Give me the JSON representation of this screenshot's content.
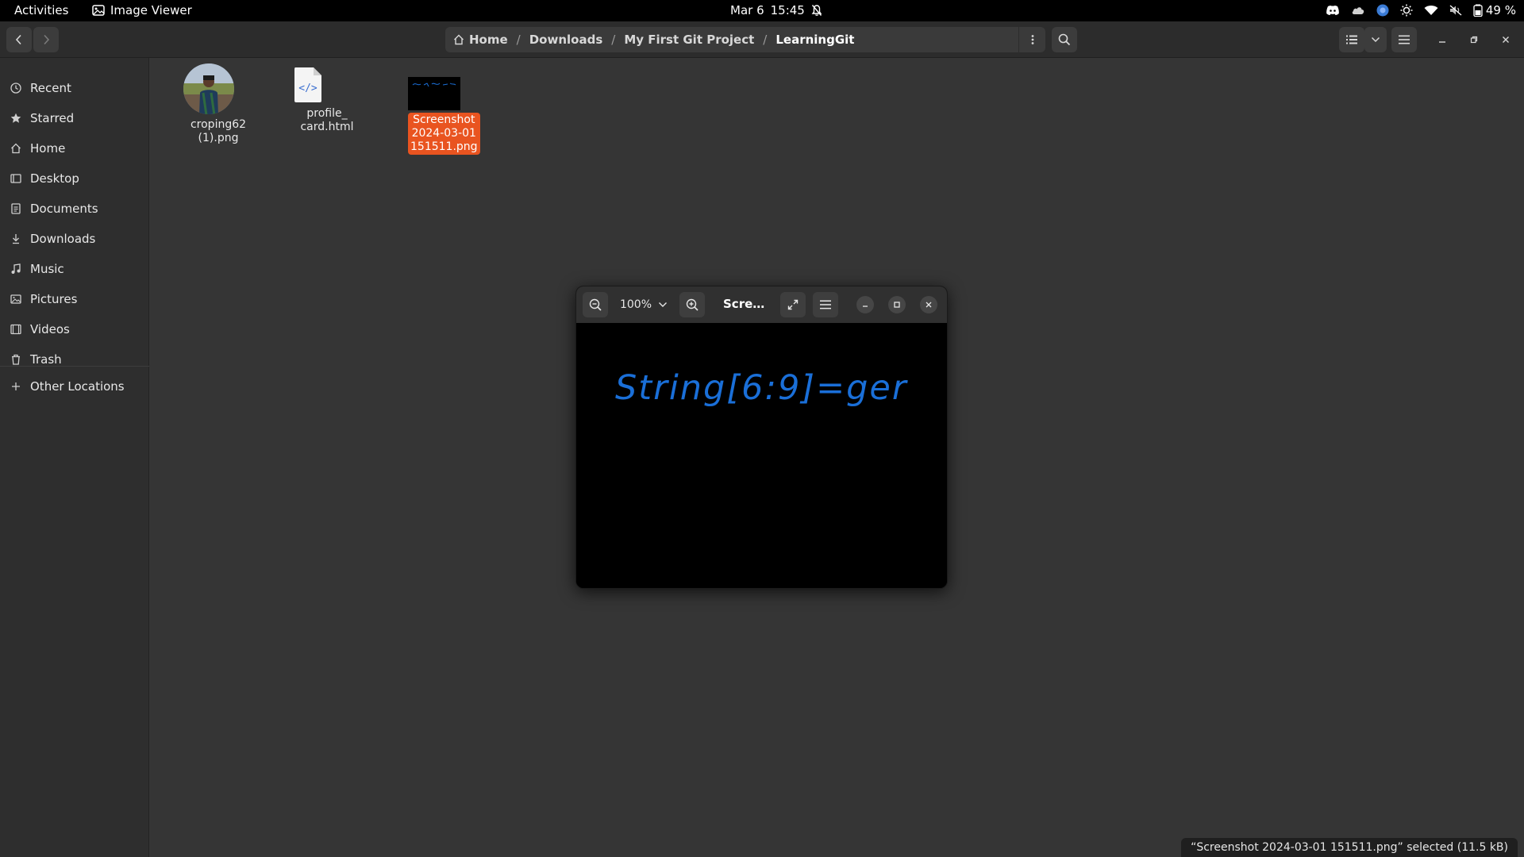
{
  "topbar": {
    "activities": "Activities",
    "app_name": "Image Viewer",
    "date": "Mar 6",
    "time": "15:45",
    "battery": "49 %"
  },
  "files": {
    "path": [
      "Home",
      "Downloads",
      "My First Git Project",
      "LearningGit"
    ],
    "sidebar": [
      {
        "label": "Recent",
        "icon": "clock-icon"
      },
      {
        "label": "Starred",
        "icon": "star-icon"
      },
      {
        "label": "Home",
        "icon": "home-icon"
      },
      {
        "label": "Desktop",
        "icon": "desktop-icon"
      },
      {
        "label": "Documents",
        "icon": "document-icon"
      },
      {
        "label": "Downloads",
        "icon": "download-icon"
      },
      {
        "label": "Music",
        "icon": "music-icon"
      },
      {
        "label": "Pictures",
        "icon": "picture-icon"
      },
      {
        "label": "Videos",
        "icon": "video-icon"
      },
      {
        "label": "Trash",
        "icon": "trash-icon"
      }
    ],
    "other_locations": "Other Locations",
    "items": [
      {
        "name_line1": "croping62",
        "name_line2": "(1).png",
        "selected": false
      },
      {
        "name_line1": "profile_",
        "name_line2": "card.html",
        "selected": false
      },
      {
        "name_line1": "Screenshot",
        "name_line2": "2024-03-01",
        "name_line3": "151511.png",
        "selected": true
      }
    ],
    "status": "“Screenshot 2024-03-01 151511.png” selected  (11.5 kB)"
  },
  "viewer": {
    "zoom": "100%",
    "title": "Scre…",
    "image_text": "String[6:9]=ger"
  },
  "colors": {
    "accent": "#e95420",
    "ink": "#1a6fd8"
  }
}
